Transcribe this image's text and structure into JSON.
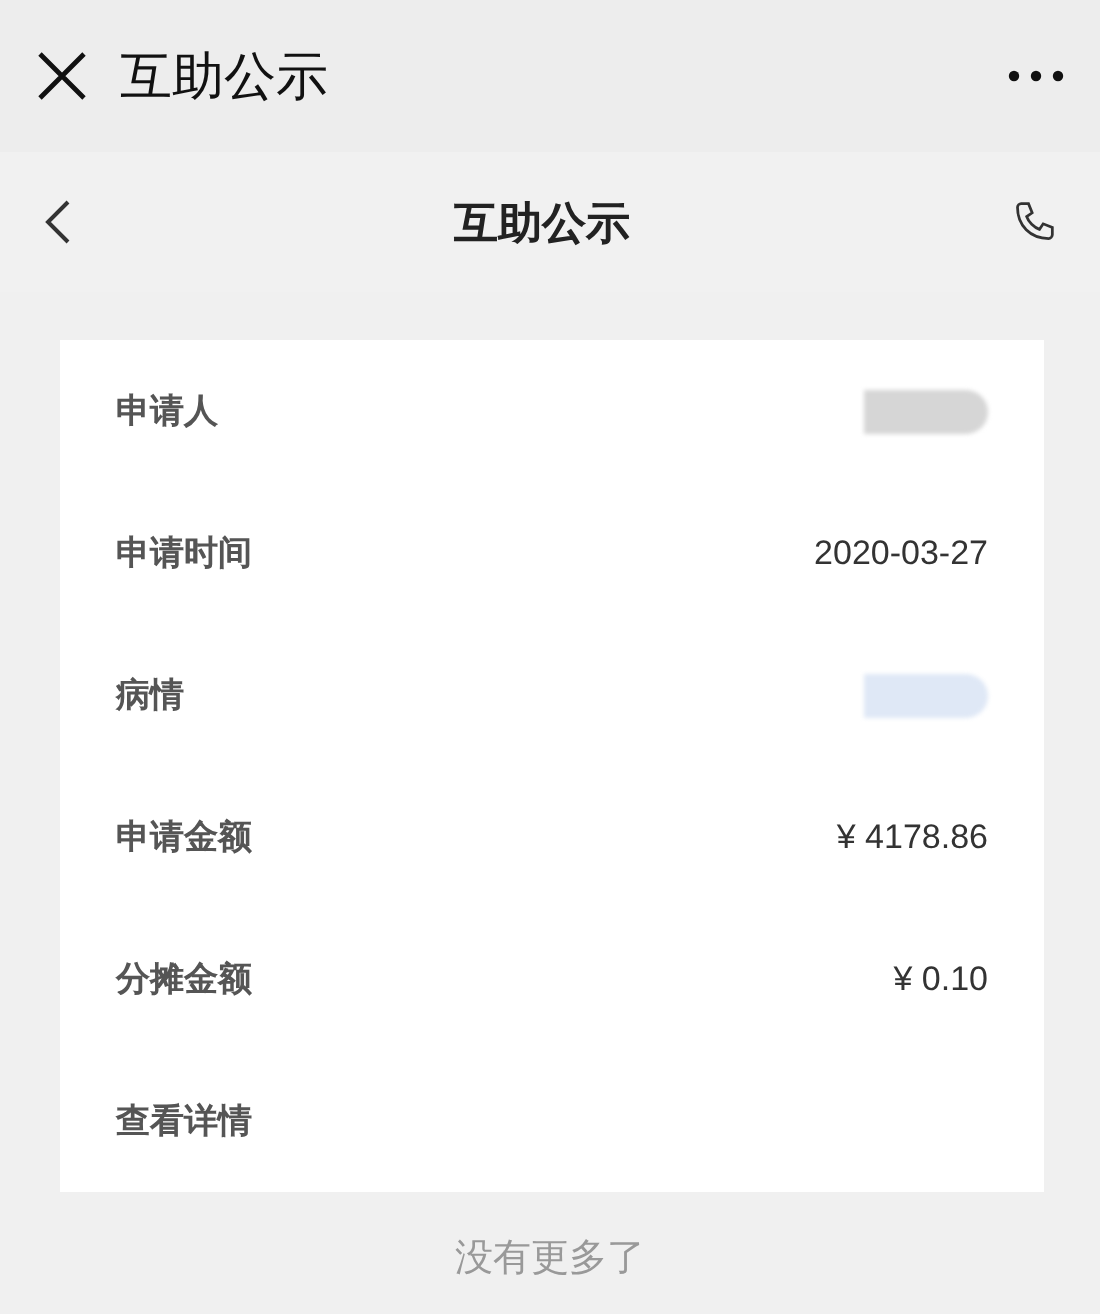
{
  "window": {
    "title": "互助公示"
  },
  "header": {
    "title": "互助公示"
  },
  "rows": [
    {
      "label": "申请人",
      "kind": "redacted",
      "color": "#d6d6d6"
    },
    {
      "label": "申请时间",
      "kind": "text",
      "value": "2020-03-27"
    },
    {
      "label": "病情",
      "kind": "redacted",
      "color": "#dfe8f6"
    },
    {
      "label": "申请金额",
      "kind": "text",
      "value": "¥ 4178.86"
    },
    {
      "label": "分摊金额",
      "kind": "text",
      "value": "¥ 0.10"
    },
    {
      "label": "查看详情",
      "kind": "link"
    }
  ],
  "footer": "没有更多了"
}
